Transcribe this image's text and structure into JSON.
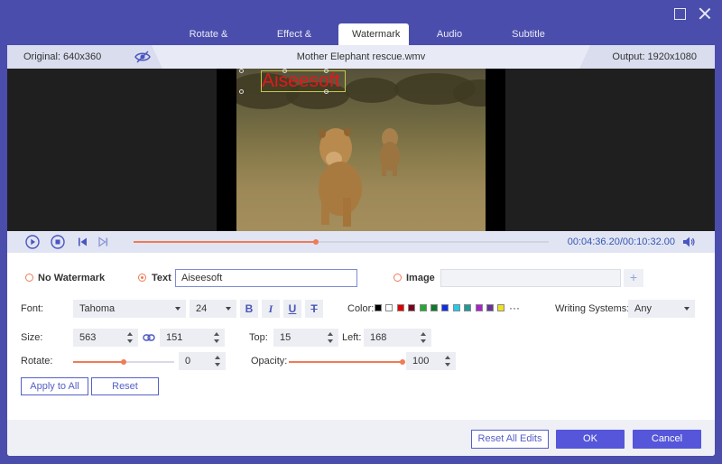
{
  "tabs": [
    {
      "label": "Rotate & Crop"
    },
    {
      "label": "Effect & Filter"
    },
    {
      "label": "Watermark"
    },
    {
      "label": "Audio"
    },
    {
      "label": "Subtitle"
    }
  ],
  "active_tab": "Watermark",
  "infobar": {
    "original": "Original: 640x360",
    "file_name": "Mother Elephant rescue.wmv",
    "output": "Output: 1920x1080"
  },
  "preview": {
    "watermark_text": "Aiseesoft",
    "watermark_color": "#e01919"
  },
  "player": {
    "current_time": "00:04:36.20",
    "total_time": "/00:10:32.00",
    "progress": 0.44
  },
  "watermark": {
    "no_watermark_label": "No Watermark",
    "text_label": "Text",
    "text_value": "Aiseesoft",
    "image_label": "Image",
    "image_value": "",
    "add_image": "+",
    "selected": "Text"
  },
  "font": {
    "label": "Font:",
    "family": "Tahoma",
    "size": "24",
    "bold": "B",
    "italic": "I",
    "underline": "U",
    "strike": "T",
    "color_label": "Color:",
    "colors": [
      "#000000",
      "#ffffff",
      "#e00000",
      "#7a0020",
      "#22aa33",
      "#0e7a2a",
      "#1030e0",
      "#22ccee",
      "#229999",
      "#aa22cc",
      "#663399",
      "#f0e020"
    ],
    "more": "···",
    "writing_label": "Writing Systems:",
    "writing_value": "Any"
  },
  "size": {
    "label": "Size:",
    "width": "563",
    "height": "151",
    "top_label": "Top:",
    "top": "15",
    "left_label": "Left:",
    "left": "168"
  },
  "rotate": {
    "label": "Rotate:",
    "value": "0",
    "slider": 0.5
  },
  "opacity": {
    "label": "Opacity:",
    "value": "100",
    "slider": 1.0
  },
  "buttons": {
    "apply_all": "Apply to All",
    "reset": "Reset",
    "reset_all": "Reset All Edits",
    "ok": "OK",
    "cancel": "Cancel"
  },
  "colors": {
    "frame": "#4a4dab",
    "accent": "#f07b56",
    "primary": "#5556d9"
  }
}
